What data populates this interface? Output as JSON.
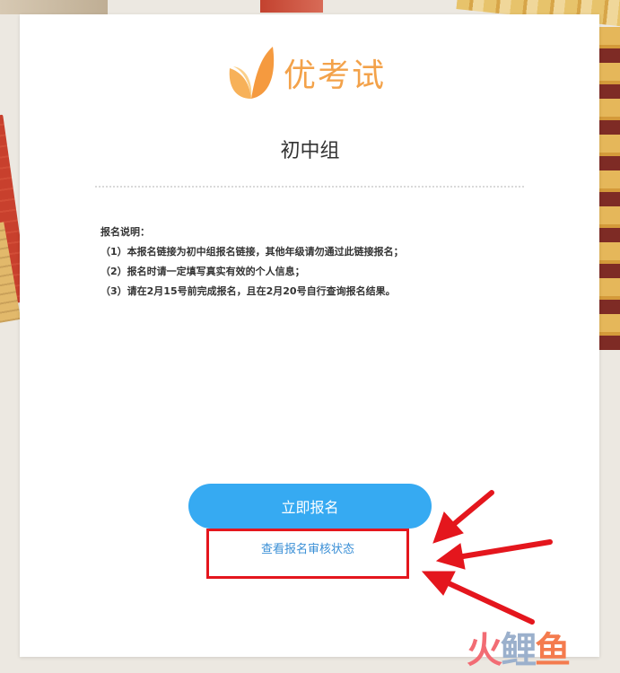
{
  "logo": {
    "text": "优考试"
  },
  "page": {
    "title": "初中组"
  },
  "instructions": {
    "heading": "报名说明：",
    "items": [
      "（1）本报名链接为初中组报名链接，其他年级请勿通过此链接报名；",
      "（2）报名时请一定填写真实有效的个人信息；",
      "（3）请在2月15号前完成报名，且在2月20号自行查询报名结果。"
    ]
  },
  "actions": {
    "register_label": "立即报名",
    "status_link_label": "查看报名审核状态"
  },
  "watermark": {
    "chars": [
      "火",
      "鲤",
      "鱼"
    ]
  },
  "colors": {
    "accent": "#36aaf2",
    "logo": "#f3a24a",
    "highlight": "#e4161d",
    "link": "#3a8fd6"
  },
  "icons": [
    "logo-leaf-icon",
    "arrow-icon"
  ]
}
